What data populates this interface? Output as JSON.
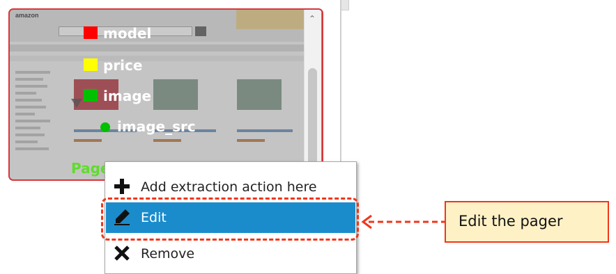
{
  "thumbnail": {
    "logo_text": "amazon",
    "labels": [
      {
        "text": "model",
        "marker": "square",
        "color": "#ff0000"
      },
      {
        "text": "price",
        "marker": "square",
        "color": "#ffff00"
      },
      {
        "text": "image",
        "marker": "square",
        "color": "#00c000"
      },
      {
        "text": "image_src",
        "marker": "dot",
        "color": "#00c000"
      }
    ],
    "pager_label": "Pager",
    "pager_color": "#5fdc2c"
  },
  "context_menu": {
    "items": [
      {
        "label": "Add extraction action here",
        "icon": "plus-icon"
      },
      {
        "label": "Edit",
        "icon": "pencil-icon",
        "selected": true
      },
      {
        "label": "Remove",
        "icon": "x-icon"
      }
    ],
    "highlight_color": "#1a8ccc"
  },
  "annotation": {
    "callout_text": "Edit the pager",
    "callout_bg": "#fff1c6",
    "accent_color": "#f0361c"
  }
}
